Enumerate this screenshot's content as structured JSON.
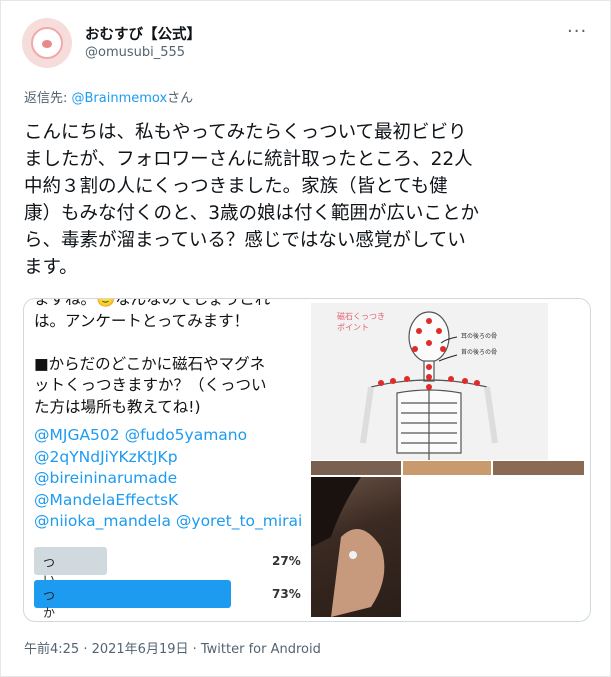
{
  "author": {
    "display_name": "おむすび【公式】",
    "handle": "@omusubi_555"
  },
  "more_icon": "more-horizontal-icon",
  "reply": {
    "prefix": "返信先: ",
    "target": "@Brainmemox",
    "suffix": "さん"
  },
  "tweet_text": "こんにちは、私もやってみたらくっついて最初ビビり\nましたが、フォロワーさんに統計取ったところ、22人\n中約３割の人にくっつきました。家族（皆とても健\n康）もみな付くのと、3歳の娘は付く範囲が広いことか\nら、毒素が溜まっている？感じではない感覚がしてい\nます。",
  "media": {
    "poll_text_top": "ますね。🙂なんなのでしょうこれ\nは。アンケートとってみます！\n\n■からだのどこかに磁石やマグネ\nットくっつきますか？（くっつい\nた方は場所も教えてね!)",
    "mentions": [
      "@MJGA502 @fudo5yamano",
      "@2qYNdJiYKzKtJKp",
      "@bireininarumade",
      "@MandelaEffectsK",
      "@niioka_mandela @yoret_to_mirai"
    ],
    "poll_options": [
      {
        "label": "ついた",
        "percent": "27%",
        "value": 27,
        "color": "#cfd9de"
      },
      {
        "label": "つかなかった",
        "percent": "73%",
        "value": 73,
        "color": "#1d9bf0"
      }
    ],
    "skeleton_title": "磁石くっつき\nポイント",
    "skeleton_notes": [
      "耳の後ろの骨",
      "首の後ろの骨"
    ]
  },
  "footer": "午前4:25 · 2021年6月19日 · Twitter for Android"
}
